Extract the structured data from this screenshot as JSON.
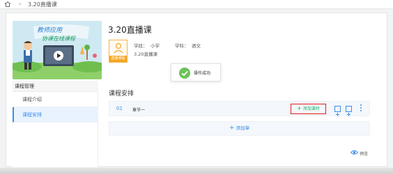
{
  "breadcrumb": {
    "current": "3.20直播课",
    "separator": ">"
  },
  "cover": {
    "banner_line1": "教师应用",
    "banner_line2": "协课在线课程"
  },
  "course": {
    "title": "3.20直播课",
    "avatar_label": "直播课程",
    "stage_label": "学段：",
    "stage_value": "小学",
    "subject_label": "学科：",
    "subject_value": "语文",
    "name_line": "3.20直播课"
  },
  "sidebar": {
    "header": "课程管理",
    "items": [
      {
        "label": "课程介绍"
      },
      {
        "label": "课程安排"
      }
    ]
  },
  "toast": {
    "text": "操作成功"
  },
  "schedule": {
    "title": "课程安排",
    "chapter": {
      "number": "01",
      "name": "章节一"
    },
    "add_lesson_label": "添加课时",
    "add_chapter_label": "添加章"
  },
  "preview_label": "预览",
  "colors": {
    "accent_blue": "#3a8ee6",
    "success_green": "#6ac259",
    "highlight_red": "#e02020",
    "add_green": "#19b26b"
  }
}
